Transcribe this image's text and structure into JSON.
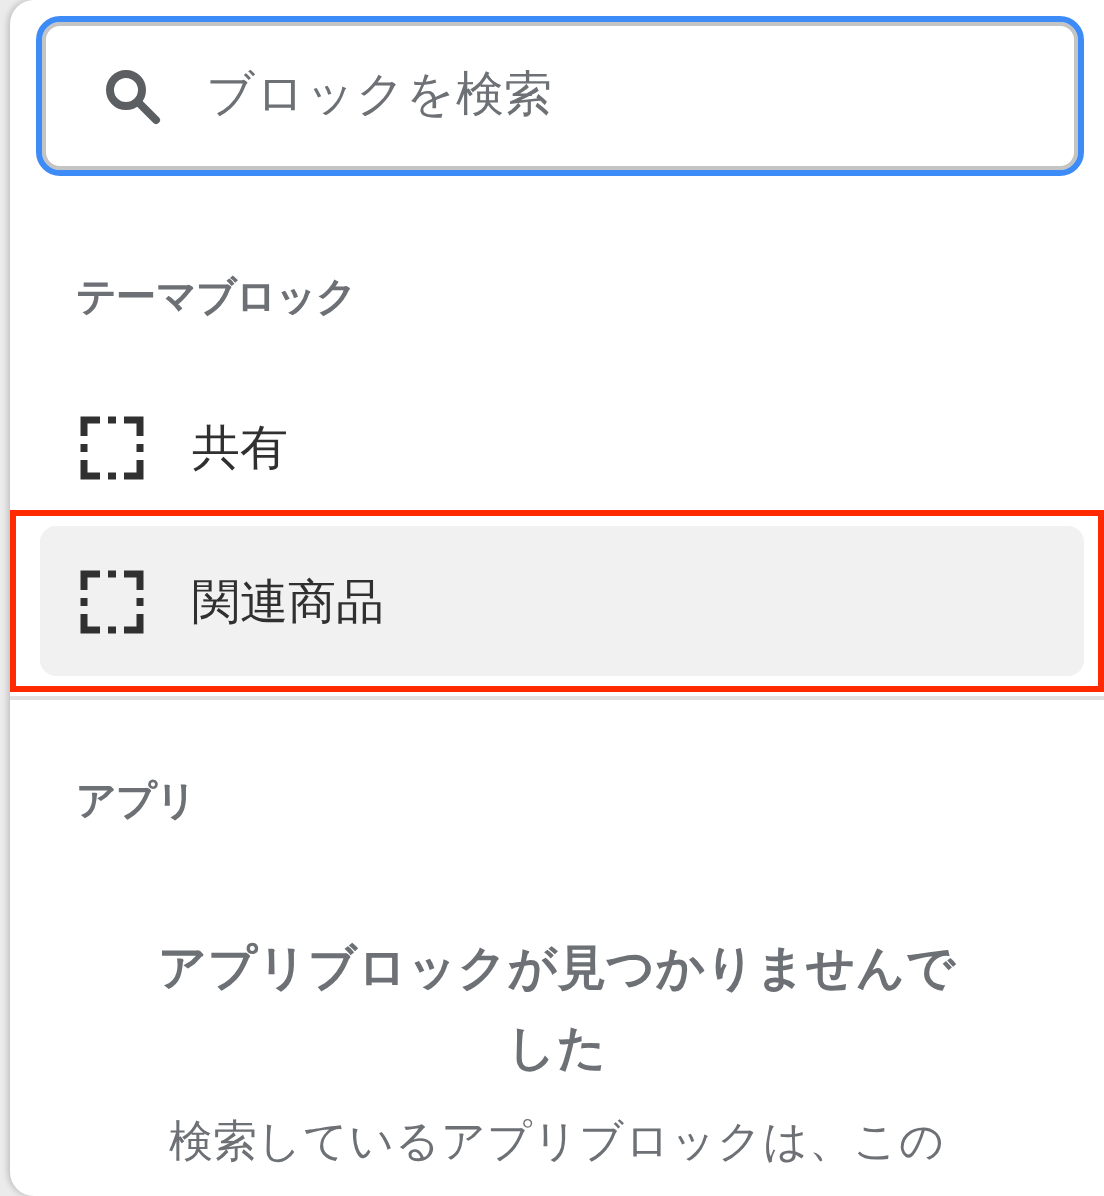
{
  "search": {
    "placeholder": "ブロックを検索",
    "focused": true
  },
  "sections": [
    {
      "title": "テーマブロック",
      "items": [
        {
          "label": "共有",
          "selected": false,
          "outlined": false
        },
        {
          "label": "関連商品",
          "selected": true,
          "outlined": true
        }
      ]
    },
    {
      "title": "アプリ",
      "empty": {
        "title": "アプリブロックが見つかりませんでした",
        "text": "検索しているアプリブロックは、この"
      }
    }
  ]
}
